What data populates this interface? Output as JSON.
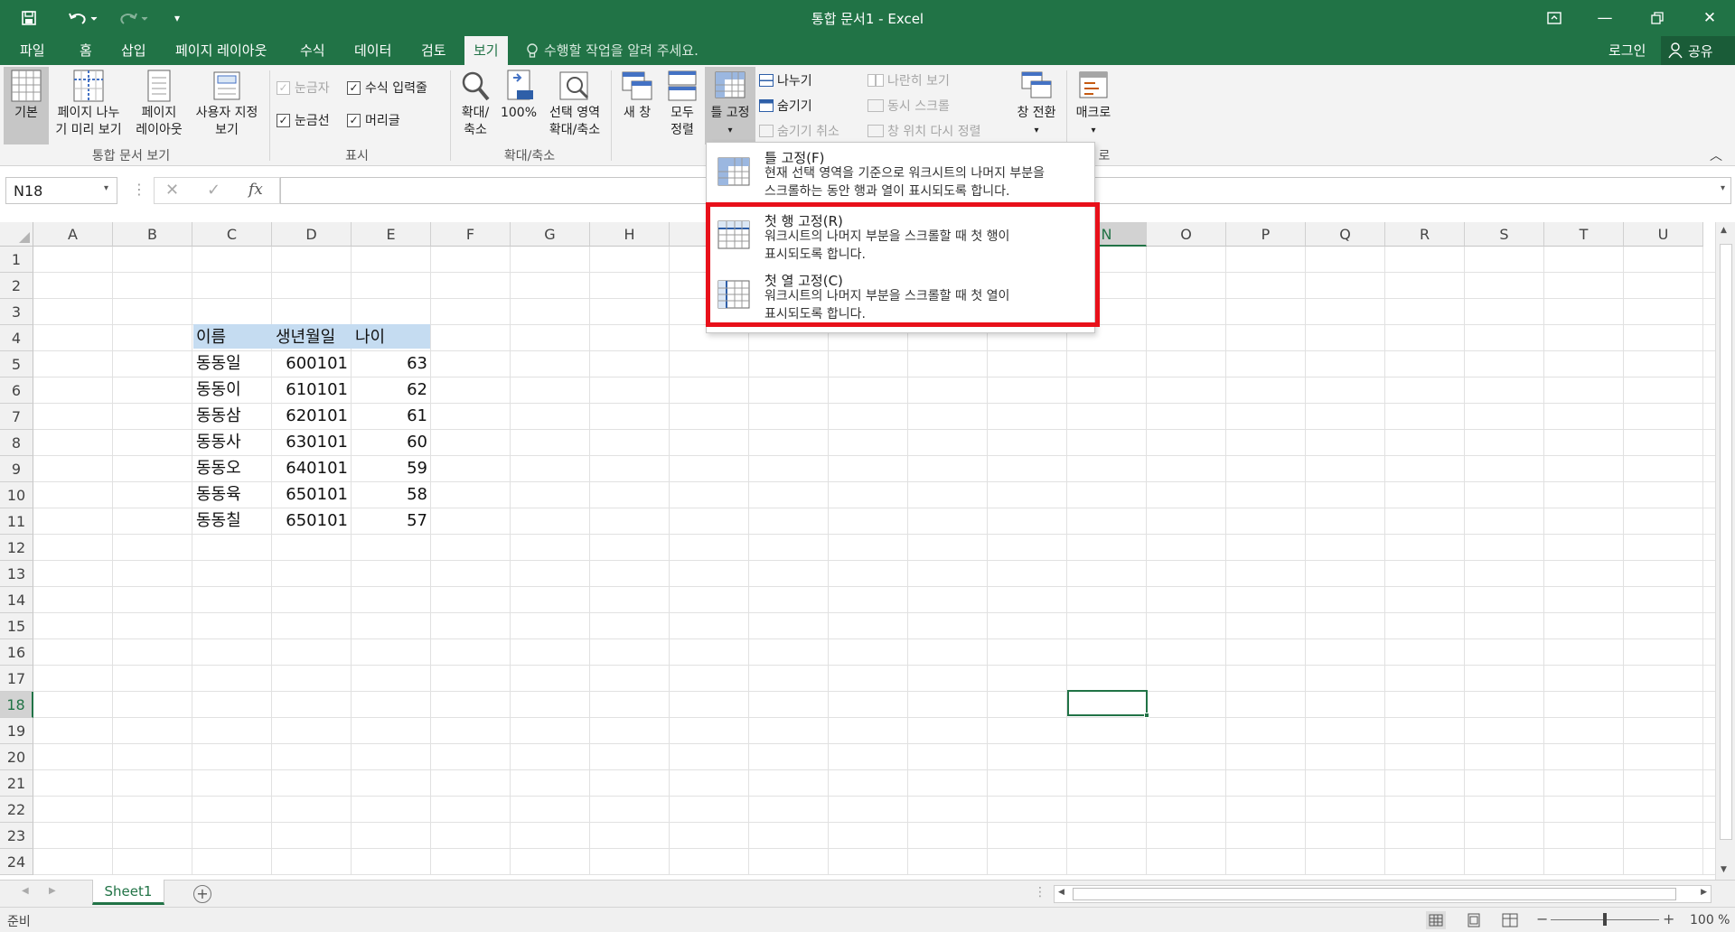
{
  "window": {
    "title": "통합 문서1 - Excel"
  },
  "account": {
    "login": "로그인",
    "share": "공유"
  },
  "tabs": [
    "파일",
    "홈",
    "삽입",
    "페이지 레이아웃",
    "수식",
    "데이터",
    "검토",
    "보기"
  ],
  "tell_me": "수행할 작업을 알려 주세요.",
  "ribbon": {
    "workbook_views": {
      "label": "통합 문서 보기",
      "normal": "기본",
      "page_break_1": "페이지 나누",
      "page_break_2": "기 미리 보기",
      "page_layout_1": "페이지",
      "page_layout_2": "레이아웃",
      "custom_1": "사용자 지정",
      "custom_2": "보기"
    },
    "show": {
      "label": "표시",
      "ruler": "눈금자",
      "formula_bar": "수식 입력줄",
      "gridlines": "눈금선",
      "headings": "머리글"
    },
    "zoom": {
      "label": "확대/축소",
      "zoom_1": "확대/",
      "zoom_2": "축소",
      "hundred": "100%",
      "selection_1": "선택 영역",
      "selection_2": "확대/축소"
    },
    "window": {
      "new_window": "새 창",
      "arrange_1": "모두",
      "arrange_2": "정렬",
      "freeze": "틀 고정",
      "split": "나누기",
      "hide": "숨기기",
      "unhide": "숨기기 취소",
      "side_by_side": "나란히 보기",
      "sync_scroll": "동시 스크롤",
      "reset_pos": "창 위치 다시 정렬",
      "switch": "창 전환"
    },
    "macros": {
      "label": "매크로",
      "macros_partial": "로"
    }
  },
  "formula_bar": {
    "name_box": "N18",
    "fx": "fx"
  },
  "columns": [
    "A",
    "B",
    "C",
    "D",
    "E",
    "F",
    "G",
    "H",
    "I",
    "J",
    "K",
    "L",
    "M",
    "N",
    "O",
    "P",
    "Q",
    "R",
    "S",
    "T",
    "U"
  ],
  "rows": [
    "1",
    "2",
    "3",
    "4",
    "5",
    "6",
    "7",
    "8",
    "9",
    "10",
    "11",
    "12",
    "13",
    "14",
    "15",
    "16",
    "17",
    "18",
    "19",
    "20",
    "21",
    "22",
    "23",
    "24"
  ],
  "table": {
    "headers": [
      "이름",
      "생년월일",
      "나이"
    ],
    "rows": [
      [
        "동동일",
        "600101",
        "63"
      ],
      [
        "동동이",
        "610101",
        "62"
      ],
      [
        "동동삼",
        "620101",
        "61"
      ],
      [
        "동동사",
        "630101",
        "60"
      ],
      [
        "동동오",
        "640101",
        "59"
      ],
      [
        "동동육",
        "650101",
        "58"
      ],
      [
        "동동칠",
        "650101",
        "57"
      ]
    ]
  },
  "freeze_menu": {
    "items": [
      {
        "title": "틀 고정(F)",
        "desc1": "현재 선택 영역을 기준으로 워크시트의 나머지 부분을",
        "desc2": "스크롤하는 동안 행과 열이 표시되도록 합니다."
      },
      {
        "title": "첫 행 고정(R)",
        "desc1": "워크시트의 나머지 부분을 스크롤할 때 첫 행이",
        "desc2": "표시되도록 합니다."
      },
      {
        "title": "첫 열 고정(C)",
        "desc1": "워크시트의 나머지 부분을 스크롤할 때 첫 열이",
        "desc2": "표시되도록 합니다."
      }
    ]
  },
  "sheets": [
    "Sheet1"
  ],
  "status": {
    "ready": "준비",
    "zoom": "100 %"
  },
  "colors": {
    "excel_green": "#217346",
    "highlight_red": "#e8101a",
    "header_fill": "#c5dcf1"
  }
}
